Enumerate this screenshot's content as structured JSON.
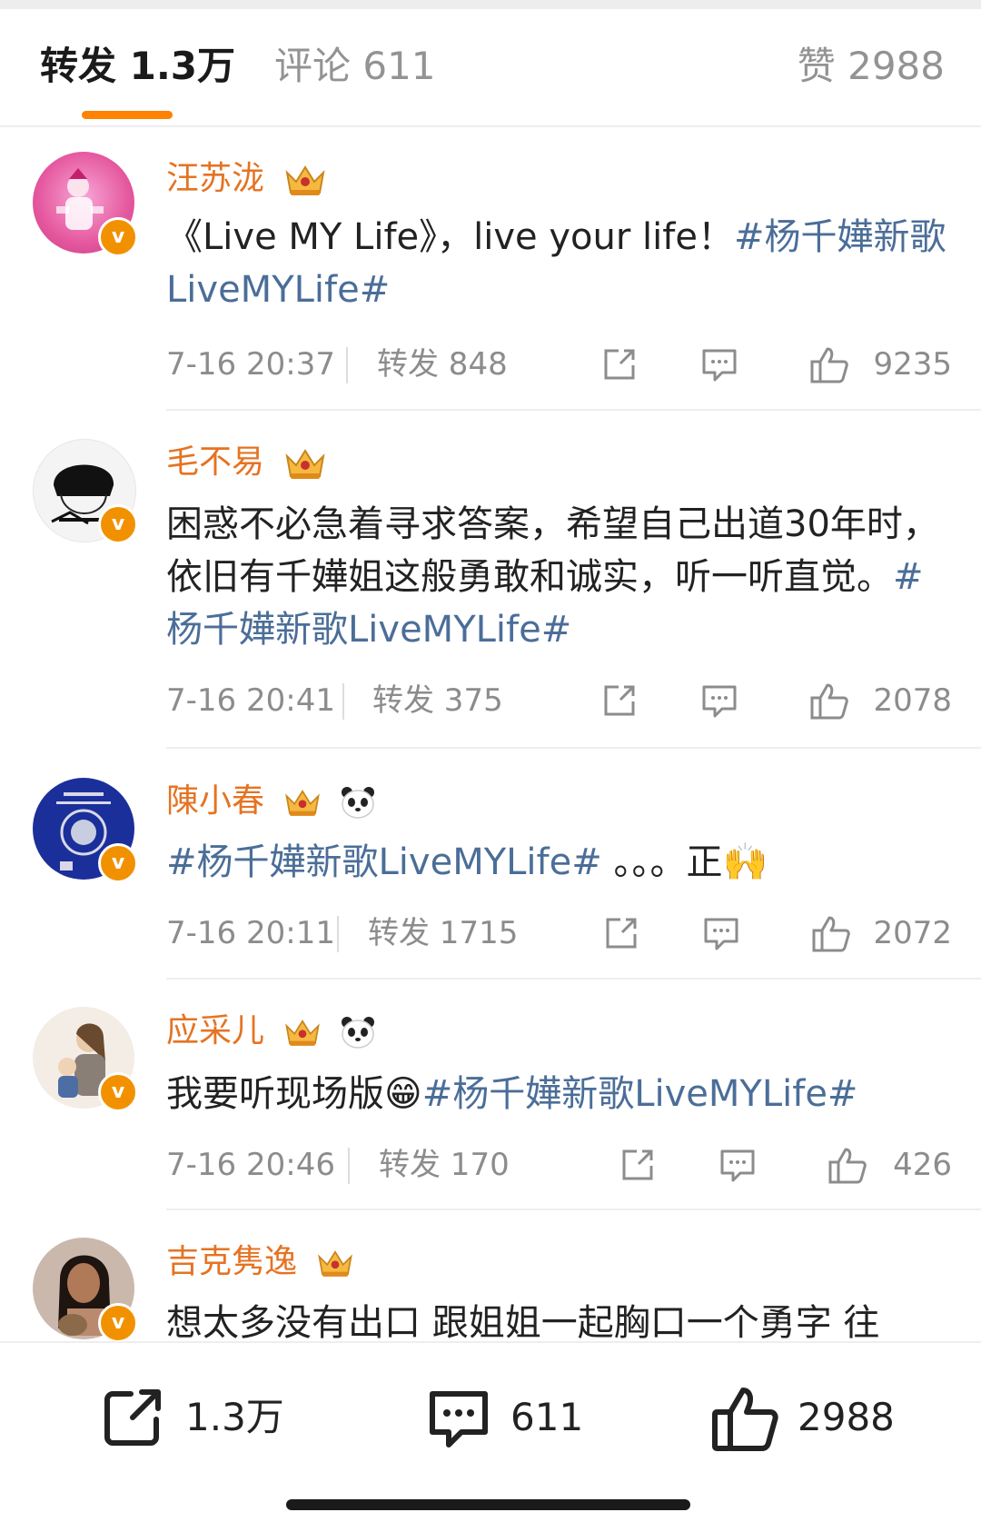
{
  "tabs": {
    "repost": "转发 1.3万",
    "comments": "评论 611",
    "likes": "赞 2988"
  },
  "entries": [
    {
      "name": "汪苏泷",
      "text_plain": "《Live MY Life》，live your life！",
      "hashtag": "#杨千嬅新歌LiveMYLife#",
      "text_after": "",
      "time": "7-16 20:37",
      "forward": "转发 848",
      "likes": "9235"
    },
    {
      "name": "毛不易",
      "text_plain": "困惑不必急着寻求答案，希望自己出道30年时，依旧有千嬅姐这般勇敢和诚实，听一听直觉。",
      "hashtag": "#杨千嬅新歌LiveMYLife#",
      "text_after": "",
      "time": "7-16 20:41",
      "forward": "转发 375",
      "likes": "2078"
    },
    {
      "name": "陳小春",
      "text_plain": "",
      "hashtag": "#杨千嬅新歌LiveMYLife#",
      "text_after": " 。。。正🙌",
      "time": "7-16 20:11",
      "forward": "转发 1715",
      "likes": "2072"
    },
    {
      "name": "应采儿",
      "text_plain": "我要听现场版😁",
      "hashtag": "#杨千嬅新歌LiveMYLife#",
      "text_after": "",
      "time": "7-16 20:46",
      "forward": "转发 170",
      "likes": "426"
    },
    {
      "name": "吉克隽逸",
      "text_plain": "想太多没有出口 跟姐姐一起胸口一个勇字 往",
      "hashtag": "",
      "text_after": "",
      "time": "",
      "forward": "",
      "likes": ""
    }
  ],
  "bottom_bar": {
    "repost_count": "1.3万",
    "comment_count": "611",
    "like_count": "2988"
  },
  "colors": {
    "accent": "#ff8200",
    "username": "#e57322",
    "hashtag": "#4b6e98",
    "meta_text": "#8c8c8c",
    "verified_badge": "#f29100"
  },
  "icons": [
    "crown-icon",
    "panda-icon",
    "verified-badge-icon",
    "share-icon",
    "comment-icon",
    "like-icon"
  ]
}
